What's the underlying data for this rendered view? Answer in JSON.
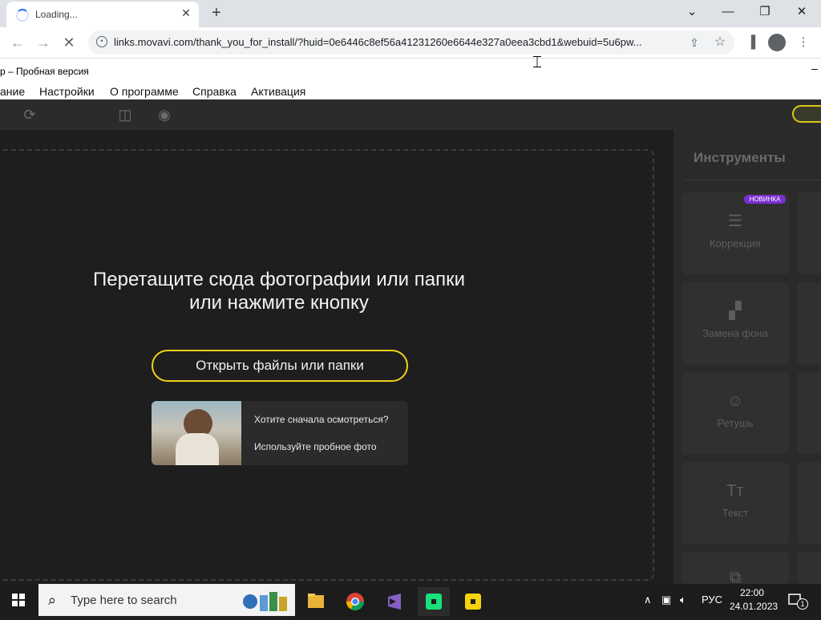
{
  "browser": {
    "tab_title": "Loading...",
    "url": "links.movavi.com/thank_you_for_install/?huid=0e6446c8ef56a41231260e6644e327a0eea3cbd1&webuid=5u6pw..."
  },
  "app": {
    "title": "р – Пробная версия",
    "menu": [
      "ание",
      "Настройки",
      "О программе",
      "Справка",
      "Активация"
    ]
  },
  "workspace": {
    "drop_line1": "Перетащите сюда фотографии или папки",
    "drop_line2": "или нажмите кнопку",
    "open_button": "Открыть файлы или папки",
    "sample_question": "Хотите сначала осмотреться?",
    "sample_action": "Используйте пробное фото"
  },
  "tools_panel": {
    "heading": "Инструменты",
    "badge": "НОВИНКА",
    "items": [
      {
        "label": "Коррекция",
        "icon": "sliders-icon"
      },
      {
        "label": "Замена фона",
        "icon": "checker-icon"
      },
      {
        "label": "Ретушь",
        "icon": "smile-icon"
      },
      {
        "label": "Текст",
        "icon": "text-icon"
      }
    ]
  },
  "taskbar": {
    "search_placeholder": "Type here to search",
    "language": "РУС",
    "time": "22:00",
    "date": "24.01.2023",
    "notification_count": "1"
  }
}
